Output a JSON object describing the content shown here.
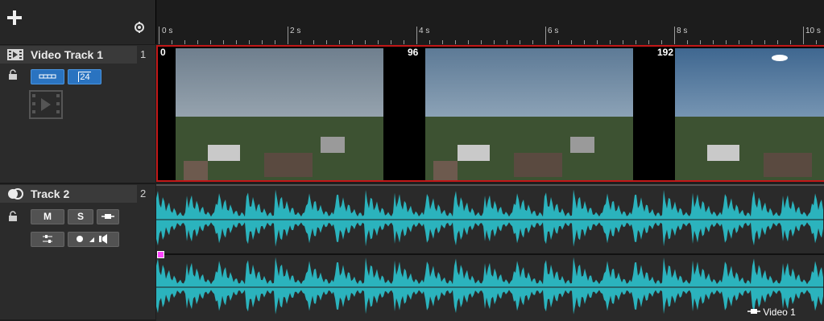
{
  "toolbar": {
    "add_label": "+"
  },
  "ruler": {
    "labels": [
      "0 s",
      "2 s",
      "4 s",
      "6 s",
      "8 s",
      "10 s"
    ]
  },
  "video_track": {
    "name": "Video Track 1",
    "number": "1",
    "thumbnail_label": "24",
    "frame_numbers": [
      "0",
      "96",
      "192"
    ]
  },
  "audio_track": {
    "name": "Track 2",
    "number": "2",
    "mute_label": "M",
    "solo_label": "S",
    "clip_name": "Video 1"
  },
  "colors": {
    "accent": "#2a73c0",
    "clip_border": "#c21818",
    "waveform": "#2bb3bd"
  }
}
